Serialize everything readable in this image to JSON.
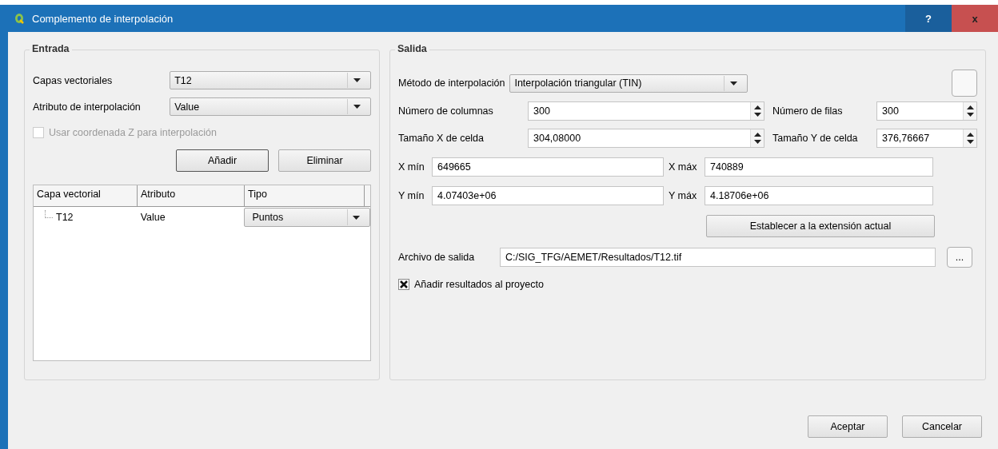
{
  "window": {
    "title": "Complemento de interpolación",
    "help_button": "?",
    "close_button": "x"
  },
  "input": {
    "title": "Entrada",
    "vector_layers": {
      "label": "Capas vectoriales",
      "value": "T12"
    },
    "attribute": {
      "label": "Atributo de interpolación",
      "value": "Value"
    },
    "use_z": {
      "label": "Usar coordenada Z para interpolación",
      "checked": false,
      "disabled": true
    },
    "buttons": [
      "Añadir",
      "Eliminar"
    ],
    "table": {
      "columns": [
        "Capa vectorial",
        "Atributo",
        "Tipo"
      ],
      "rows": [
        {
          "layer": "T12",
          "attribute": "Value",
          "type": "Puntos"
        }
      ]
    }
  },
  "output": {
    "title": "Salida",
    "method": {
      "label": "Método de interpolación",
      "value": "Interpolación triangular (TIN)"
    },
    "columns": {
      "label": "Número de columnas",
      "value": "300"
    },
    "rows": {
      "label": "Número de filas",
      "value": "300"
    },
    "cell_x": {
      "label": "Tamaño X de celda",
      "value": "304,08000"
    },
    "cell_y": {
      "label": "Tamaño Y de celda",
      "value": "376,76667"
    },
    "x_min": {
      "label": "X mín",
      "value": "649665"
    },
    "x_max": {
      "label": "X máx",
      "value": "740889"
    },
    "y_min": {
      "label": "Y mín",
      "value": "4.07403e+06"
    },
    "y_max": {
      "label": "Y máx",
      "value": "4.18706e+06"
    },
    "extent_button": "Establecer a la extensión actual",
    "output_file": {
      "label": "Archivo de salida",
      "value": "C:/SIG_TFG/AEMET/Resultados/T12.tif",
      "browse_button": "..."
    },
    "add_results": {
      "label": "Añadir resultados al proyecto",
      "checked": true
    }
  },
  "buttons": [
    "Aceptar",
    "Cancelar"
  ]
}
